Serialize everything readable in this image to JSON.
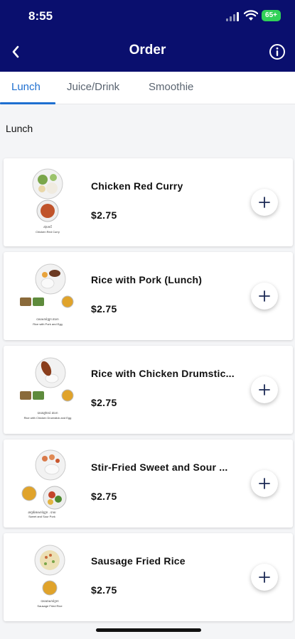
{
  "status_bar": {
    "time": "8:55",
    "battery": "65+"
  },
  "header": {
    "title": "Order"
  },
  "tabs": [
    {
      "label": "Lunch",
      "active": true
    },
    {
      "label": "Juice/Drink",
      "active": false
    },
    {
      "label": "Smoothie",
      "active": false
    }
  ],
  "section": {
    "title": "Lunch"
  },
  "items": [
    {
      "name": "Chicken Red Curry",
      "price": "$2.75"
    },
    {
      "name": "Rice with Pork (Lunch)",
      "price": "$2.75"
    },
    {
      "name": "Rice with Chicken Drumstic...",
      "price": "$2.75"
    },
    {
      "name": "Stir-Fried Sweet and Sour ...",
      "price": "$2.75"
    },
    {
      "name": "Sausage Fried Rice",
      "price": "$2.75"
    }
  ],
  "colors": {
    "header_bg": "#0a0f6e",
    "active_tab": "#1e6fd0",
    "battery": "#31d158"
  },
  "icons": [
    "chevron-left-icon",
    "info-icon",
    "plus-icon"
  ]
}
